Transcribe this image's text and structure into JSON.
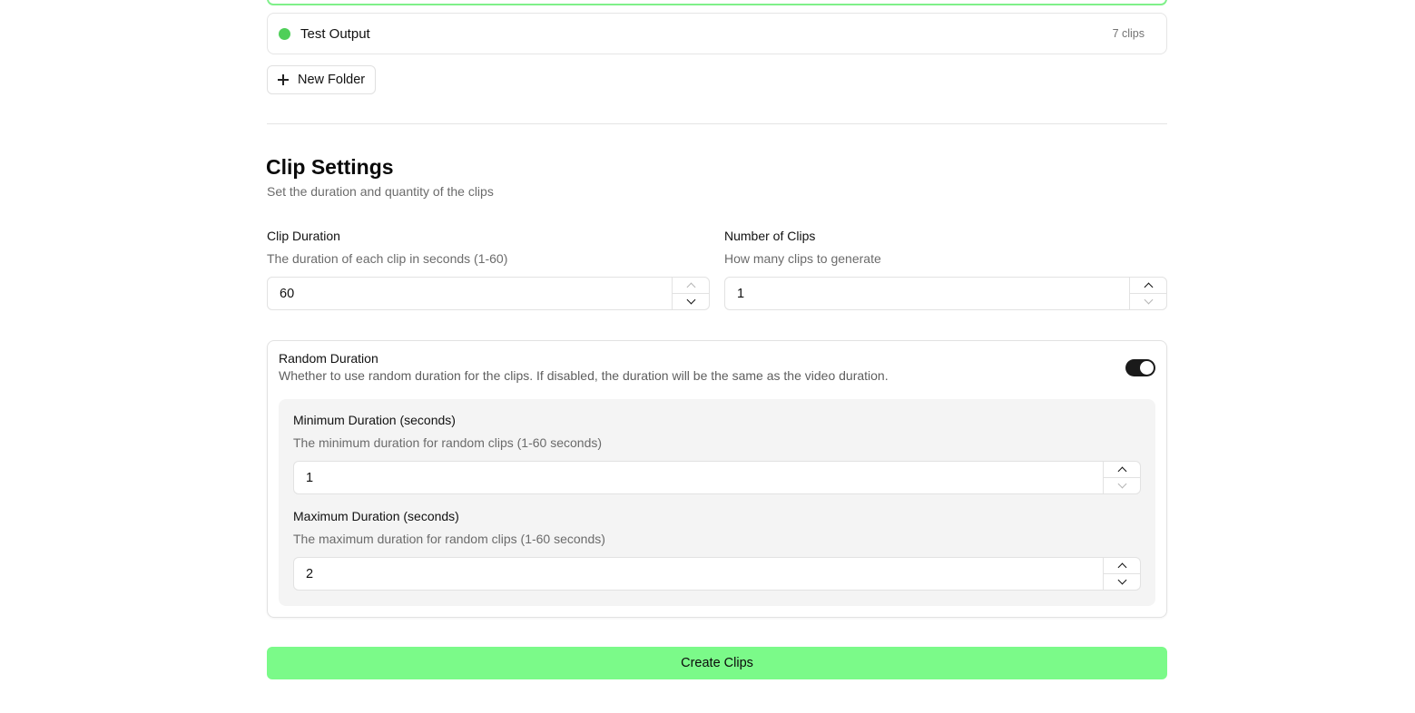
{
  "folders": {
    "items": [
      {
        "name": "Test Output",
        "count": "7 clips",
        "dot_color": "#4fcf59"
      }
    ],
    "new_folder_label": "New Folder"
  },
  "clip_settings": {
    "title": "Clip Settings",
    "description": "Set the duration and quantity of the clips",
    "clip_duration": {
      "label": "Clip Duration",
      "help": "The duration of each clip in seconds (1-60)",
      "value": "60"
    },
    "number_of_clips": {
      "label": "Number of Clips",
      "help": "How many clips to generate",
      "value": "1"
    },
    "random_duration": {
      "label": "Random Duration",
      "description": "Whether to use random duration for the clips. If disabled, the duration will be the same as the video duration.",
      "enabled": true,
      "min": {
        "label": "Minimum Duration (seconds)",
        "help": "The minimum duration for random clips (1-60 seconds)",
        "value": "1"
      },
      "max": {
        "label": "Maximum Duration (seconds)",
        "help": "The maximum duration for random clips (1-60 seconds)",
        "value": "2"
      }
    }
  },
  "create_button_label": "Create Clips",
  "colors": {
    "accent_green": "#7bfa89",
    "toggle_on": "#1a1a1a"
  }
}
